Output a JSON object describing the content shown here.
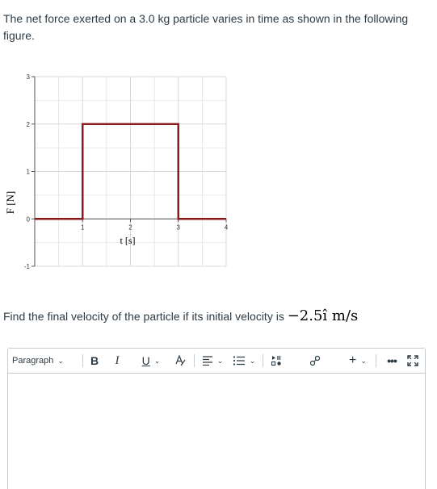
{
  "question": {
    "intro": "The net force exerted on a 3.0 kg particle varies in time as shown in the following figure.",
    "prompt_prefix": "Find the final velocity of the particle if its initial velocity is ",
    "prompt_math": "−2.5î m/s"
  },
  "chart_data": {
    "type": "line",
    "xlabel": "t [s]",
    "ylabel": "F [N]",
    "xlim": [
      0,
      4
    ],
    "ylim": [
      -1,
      3
    ],
    "x_ticks": [
      "1",
      "2",
      "3",
      "4"
    ],
    "y_ticks": [
      "-1",
      "0",
      "1",
      "2",
      "3"
    ],
    "grid": true,
    "series": [
      {
        "color": "#8b1a1a",
        "points": [
          [
            0,
            0
          ],
          [
            1,
            0
          ],
          [
            1,
            2
          ],
          [
            3,
            2
          ],
          [
            3,
            0
          ],
          [
            4,
            0
          ]
        ]
      }
    ]
  },
  "editor": {
    "paragraph_label": "Paragraph",
    "bold_label": "B",
    "italic_label": "I",
    "underline_label": "U",
    "more_label": "⋮",
    "plus_label": "+"
  },
  "colors": {
    "force_line": "#8b1a1a",
    "grid": "#d9d9d9",
    "axis": "#555555"
  }
}
